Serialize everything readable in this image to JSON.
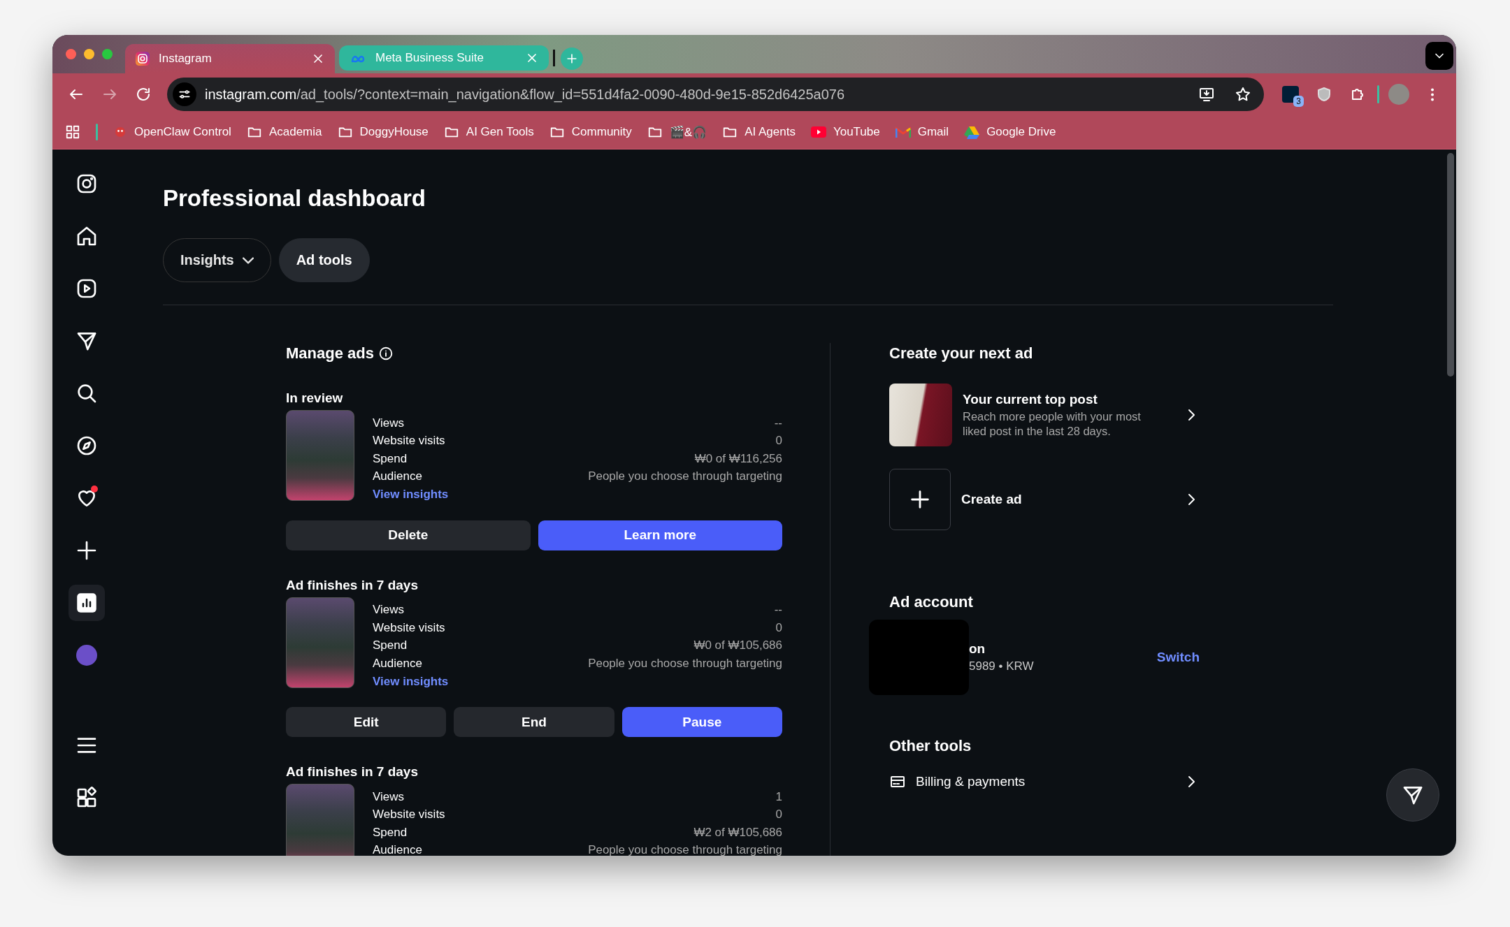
{
  "browser": {
    "tabs": [
      {
        "title": "Instagram",
        "kind": "camera",
        "selected": true,
        "color": "#a64a63"
      },
      {
        "title": "Meta Business Suite",
        "kind": "infinity",
        "selected": false,
        "color": "#2fb79c"
      }
    ],
    "address": {
      "host": "instagram.com",
      "path": "/ad_tools/?context=main_navigation&flow_id=551d4fa2-0090-480d-9e15-852d6425a076"
    },
    "extension_badge": "3",
    "bookmarks": [
      {
        "label": "OpenClaw Control",
        "kind": "app"
      },
      {
        "label": "Academia",
        "kind": "folder"
      },
      {
        "label": "DoggyHouse",
        "kind": "folder"
      },
      {
        "label": "AI Gen Tools",
        "kind": "folder"
      },
      {
        "label": "Community",
        "kind": "folder"
      },
      {
        "label": "🎬&🎧",
        "kind": "folder"
      },
      {
        "label": "AI Agents",
        "kind": "folder"
      },
      {
        "label": "YouTube",
        "kind": "video"
      },
      {
        "label": "Gmail",
        "kind": "mail"
      },
      {
        "label": "Google Drive",
        "kind": "drive"
      }
    ]
  },
  "sidebar": {
    "items": [
      {
        "kind": "logo",
        "selected": false,
        "unread": false
      },
      {
        "kind": "home",
        "selected": false,
        "unread": false
      },
      {
        "kind": "reels",
        "selected": false,
        "unread": false
      },
      {
        "kind": "messages",
        "selected": false,
        "unread": false
      },
      {
        "kind": "search",
        "selected": false,
        "unread": false
      },
      {
        "kind": "explore",
        "selected": false,
        "unread": false
      },
      {
        "kind": "notifications",
        "selected": false,
        "unread": true
      },
      {
        "kind": "create",
        "selected": false,
        "unread": false
      },
      {
        "kind": "dashboard",
        "selected": true,
        "unread": false
      },
      {
        "kind": "profile",
        "selected": false,
        "unread": false
      },
      {
        "kind": "more",
        "selected": false,
        "unread": false
      },
      {
        "kind": "apps",
        "selected": false,
        "unread": false
      }
    ]
  },
  "page": {
    "title": "Professional dashboard",
    "tabs": [
      {
        "label": "Insights",
        "kind": "dropdown",
        "selected": false
      },
      {
        "label": "Ad tools",
        "kind": "plain",
        "selected": true
      }
    ]
  },
  "manage_ads": {
    "title": "Manage ads",
    "ads": [
      {
        "status": "In review",
        "stats": [
          {
            "label": "Views",
            "value": "--"
          },
          {
            "label": "Website visits",
            "value": "0"
          },
          {
            "label": "Spend",
            "value": "₩0 of ₩116,256"
          },
          {
            "label": "Audience",
            "value": "People you choose through targeting"
          }
        ],
        "link": "View insights",
        "actions": [
          {
            "label": "Delete",
            "primary": false
          },
          {
            "label": "Learn more",
            "primary": true
          }
        ]
      },
      {
        "status": "Ad finishes in 7 days",
        "stats": [
          {
            "label": "Views",
            "value": "--"
          },
          {
            "label": "Website visits",
            "value": "0"
          },
          {
            "label": "Spend",
            "value": "₩0 of ₩105,686"
          },
          {
            "label": "Audience",
            "value": "People you choose through targeting"
          }
        ],
        "link": "View insights",
        "actions": [
          {
            "label": "Edit",
            "primary": false
          },
          {
            "label": "End",
            "primary": false
          },
          {
            "label": "Pause",
            "primary": true
          }
        ]
      },
      {
        "status": "Ad finishes in 7 days",
        "stats": [
          {
            "label": "Views",
            "value": "1"
          },
          {
            "label": "Website visits",
            "value": "0"
          },
          {
            "label": "Spend",
            "value": "₩2 of ₩105,686"
          },
          {
            "label": "Audience",
            "value": "People you choose through targeting"
          }
        ]
      }
    ]
  },
  "create": {
    "title": "Create your next ad",
    "items": [
      {
        "kind": "top_post",
        "title": "Your current top post",
        "description": "Reach more people with your most liked post in the last 28 days."
      },
      {
        "kind": "create",
        "title": "Create ad"
      }
    ]
  },
  "ad_account": {
    "title": "Ad account",
    "name": "on",
    "detail": "5989 • KRW",
    "action": "Switch"
  },
  "other_tools": {
    "title": "Other tools",
    "items": [
      {
        "label": "Billing & payments"
      }
    ]
  }
}
